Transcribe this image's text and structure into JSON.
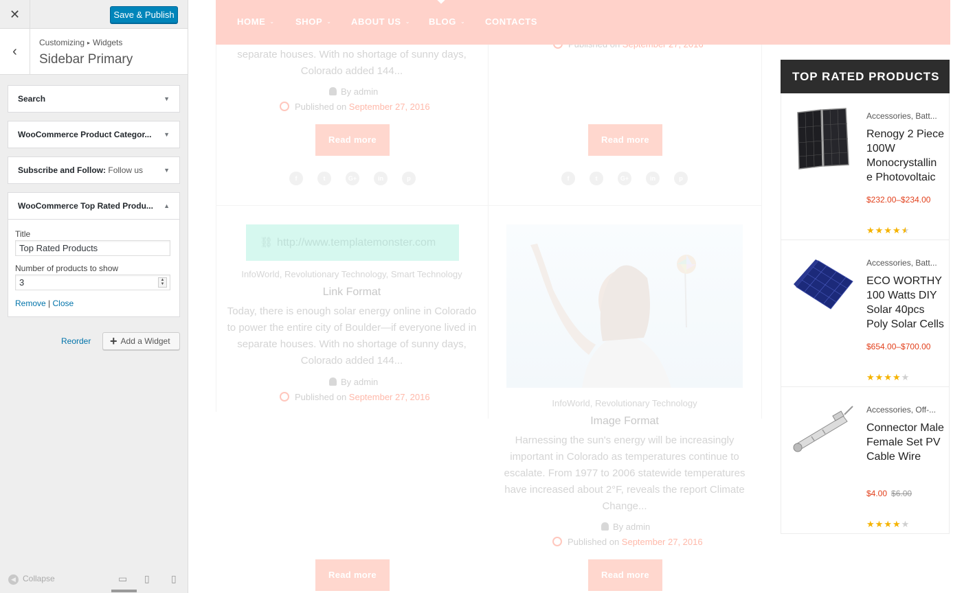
{
  "customizer": {
    "close_icon": "close-icon",
    "save_button": "Save & Publish",
    "breadcrumb": {
      "root": "Customizing",
      "separator": "▸",
      "child": "Widgets"
    },
    "section_title": "Sidebar Primary",
    "widgets": [
      {
        "title": "Search",
        "subtitle": "",
        "expanded": false
      },
      {
        "title": "WooCommerce Product Categor...",
        "subtitle": "",
        "expanded": false
      },
      {
        "title": "Subscribe and Follow:",
        "subtitle": "Follow us",
        "expanded": false
      },
      {
        "title": "WooCommerce Top Rated Produ...",
        "subtitle": "",
        "expanded": true
      }
    ],
    "form": {
      "title_label": "Title",
      "title_value": "Top Rated Products",
      "count_label": "Number of products to show",
      "count_value": "3",
      "remove_link": "Remove",
      "separator": "|",
      "close_link": "Close"
    },
    "reorder_link": "Reorder",
    "add_widget_button": "Add a Widget",
    "collapse_label": "Collapse",
    "device_icons": [
      "desktop-icon",
      "tablet-icon",
      "mobile-icon"
    ],
    "accent_color": "#0085ba"
  },
  "preview": {
    "nav": [
      "HOME",
      "SHOP",
      "ABOUT US",
      "BLOG",
      "CONTACTS"
    ],
    "nav_color": "#ffd2ca",
    "left_post_top": {
      "excerpt_lines": [
        "separate houses. With no shortage of sunny days,",
        "Colorado added 144..."
      ],
      "author": "By admin",
      "published_prefix": "Published on",
      "date": "September 27, 2016",
      "read_more": "Read more"
    },
    "right_post_top": {
      "published_prefix": "Published on",
      "date": "September 27, 2016",
      "read_more": "Read more"
    },
    "social_icons": [
      "f",
      "t",
      "G+",
      "in",
      "p"
    ],
    "link_post": {
      "url": "http://www.templatemonster.com",
      "categories": "InfoWorld, Revolutionary Technology, Smart Technology",
      "title": "Link Format",
      "excerpt_lines": [
        "Today, there is enough solar energy online in Colorado",
        "to power the entire city of Boulder—if everyone lived in",
        "separate houses. With no shortage of sunny days,",
        "Colorado added 144..."
      ],
      "author": "By admin",
      "published_prefix": "Published on",
      "date": "September 27, 2016"
    },
    "image_post": {
      "categories": "InfoWorld, Revolutionary Technology",
      "title": "Image Format",
      "excerpt_lines": [
        "Harnessing the sun's energy will be increasingly",
        "important in Colorado as temperatures continue to",
        "escalate. From 1977 to 2006 statewide temperatures",
        "have increased about 2°F, reveals the report Climate",
        "Change..."
      ],
      "author": "By admin",
      "published_prefix": "Published on",
      "date": "September 27, 2016",
      "read_more": "Read more"
    },
    "link_post_read_more": "Read more",
    "top_rated": {
      "title": "TOP RATED PRODUCTS",
      "products": [
        {
          "category": "Accessories, Batt...",
          "name": "Renogy 2 Piece 100W Monocrystallin e Photovoltaic",
          "price": "$232.00–$234.00",
          "old_price": "",
          "rating": 4.5
        },
        {
          "category": "Accessories, Batt...",
          "name": "ECO WORTHY 100 Watts DIY Solar 40pcs Poly Solar Cells",
          "price": "$654.00–$700.00",
          "old_price": "",
          "rating": 4
        },
        {
          "category": "Accessories, Off-...",
          "name": "Connector Male Female Set PV Cable Wire",
          "price": "$4.00",
          "old_price": "$6.00",
          "rating": 4
        }
      ]
    }
  }
}
